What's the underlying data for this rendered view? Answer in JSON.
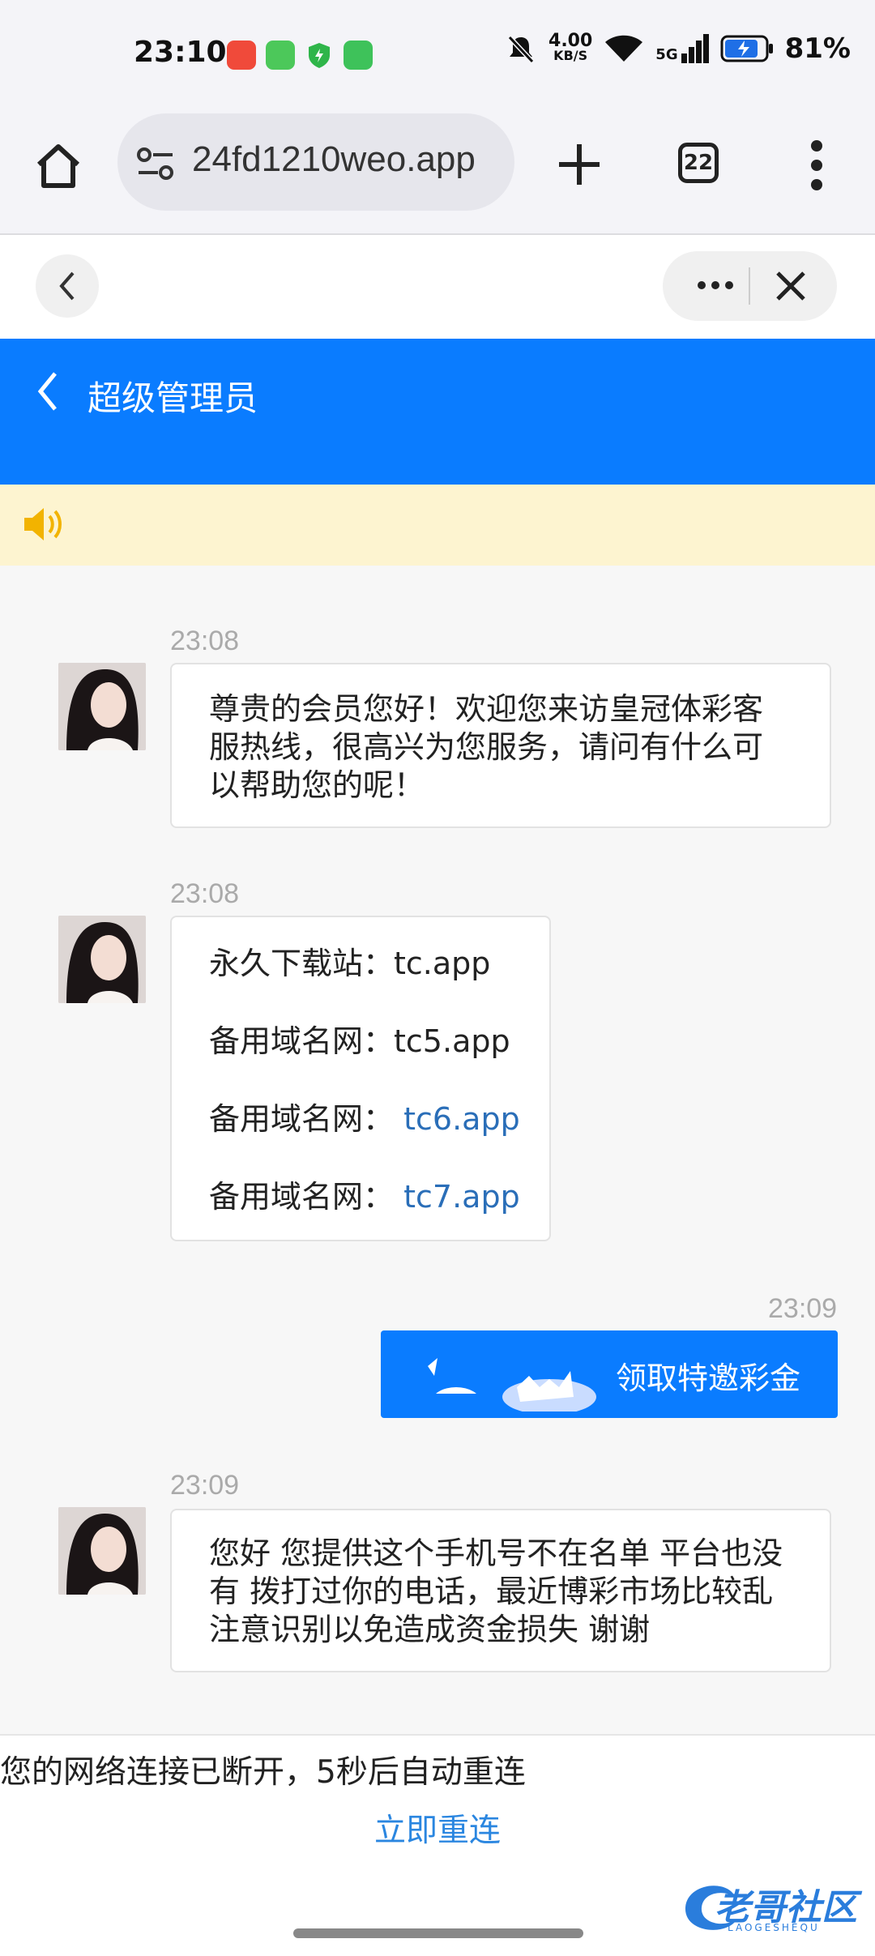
{
  "status_bar": {
    "time": "23:10",
    "net_speed_value": "4.00",
    "net_speed_unit": "KB/S",
    "network": "5G",
    "battery": "81%"
  },
  "browser": {
    "url": "24fd1210weo.app",
    "tab_count": "22"
  },
  "chat": {
    "title": "超级管理员",
    "notice_text": ""
  },
  "messages": [
    {
      "time": "23:08",
      "lines": [
        "尊贵的会员您好！欢迎您来访皇冠体彩客",
        "服热线，很高兴为您服务，请问有什么可",
        "以帮助您的呢！"
      ]
    },
    {
      "time": "23:08",
      "rows": [
        {
          "label": "永久下载站：",
          "link": "tc.app"
        },
        {
          "label": "备用域名网：",
          "link": "tc5.app"
        },
        {
          "label": "备用域名网：",
          "link": "tc6.app"
        },
        {
          "label": "备用域名网：",
          "link": "tc7.app"
        }
      ]
    },
    {
      "time": "23:09",
      "text": "领取特邀彩金"
    },
    {
      "time": "23:09",
      "lines": [
        "您好 您提供这个手机号不在名单 平台也没",
        "有 拨打过你的电话，最近博彩市场比较乱",
        "注意识别以免造成资金损失 谢谢"
      ]
    }
  ],
  "footer": {
    "network_message": "您的网络连接已断开，5秒后自动重连",
    "reconnect_label": "立即重连",
    "watermark_text": "老哥社区",
    "watermark_sub": "LAOGESHEQU"
  },
  "colors": {
    "brand_blue": "#0a7cff",
    "link_blue": "#2a6eb8",
    "notice_bg": "#fdf4d0"
  }
}
